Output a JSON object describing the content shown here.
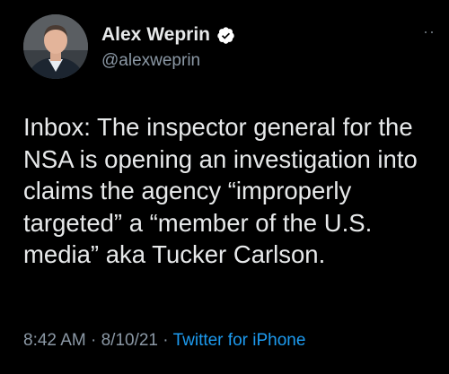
{
  "author": {
    "display_name": "Alex Weprin",
    "handle": "@alexweprin",
    "verified": true,
    "verified_icon": "verified-badge-icon"
  },
  "more_icon": "more-options-icon",
  "tweet": {
    "text": "Inbox: The inspector general for the\nNSA is opening an investigation into\nclaims the agency “improperly\ntargeted” a “member of the U.S.\nmedia” aka Tucker Carlson."
  },
  "meta": {
    "time": "8:42 AM",
    "separator": " · ",
    "date": "8/10/21",
    "source": "Twitter for iPhone"
  },
  "colors": {
    "background": "#000000",
    "text": "#e7e9ea",
    "secondary": "#8b98a5",
    "link": "#1d9bf0"
  }
}
